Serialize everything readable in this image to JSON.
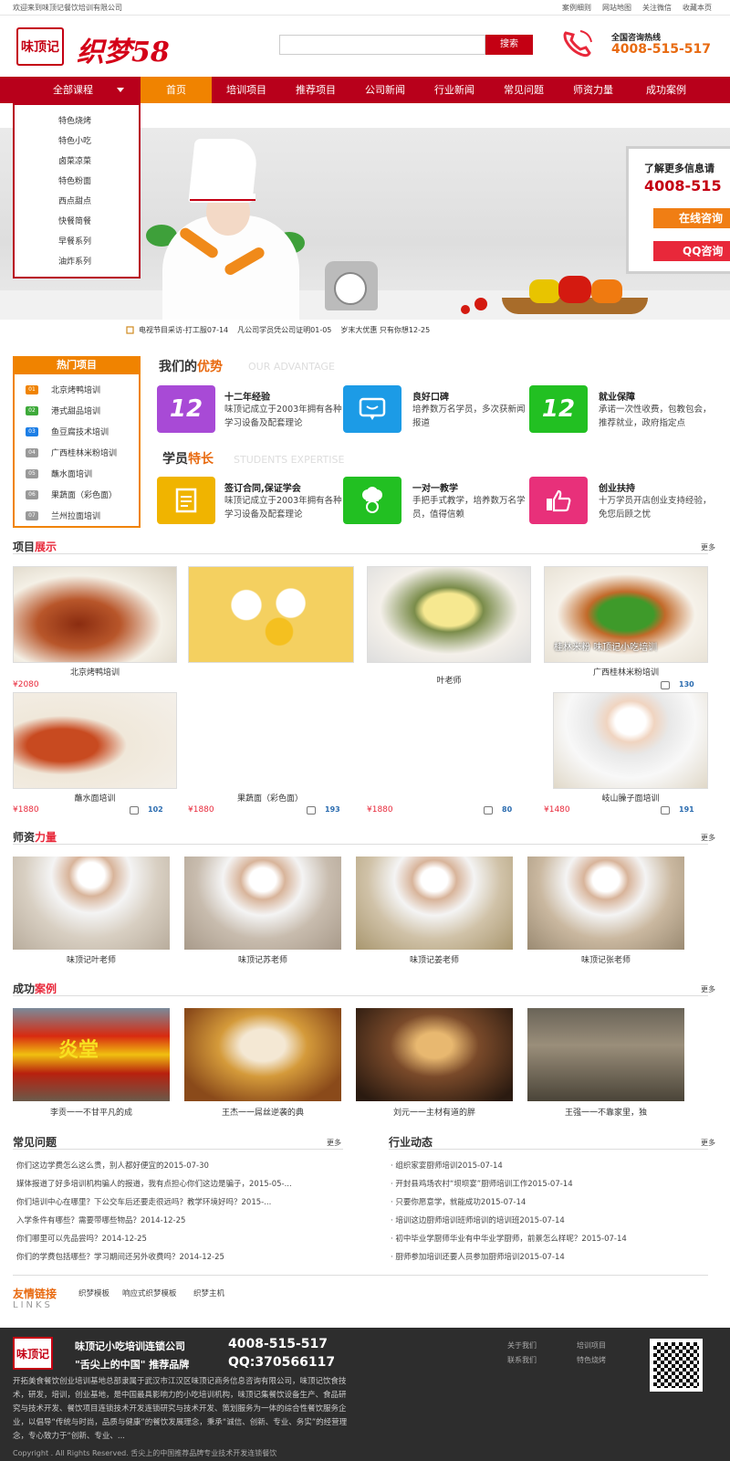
{
  "topbar": {
    "welcome": "欢迎来到味顶记餐饮培训有限公司",
    "links": [
      "案例细则",
      "网站地图",
      "关注微信",
      "收藏本页"
    ]
  },
  "header": {
    "logo_text": "味顶记",
    "brand": "织梦58",
    "search_placeholder": "",
    "search_button": "搜索",
    "hotline_label": "全国咨询热线",
    "hotline_number": "4008-515-517",
    "phone_icon": "phone-icon"
  },
  "nav": {
    "all_courses": "全部课程",
    "items": [
      "首页",
      "培训项目",
      "推荐项目",
      "公司新闻",
      "行业新闻",
      "常见问题",
      "师资力量",
      "成功案例"
    ],
    "active_index": 0,
    "dropdown": [
      "特色烧烤",
      "特色小吃",
      "卤菜凉菜",
      "特色粉面",
      "西点甜点",
      "快餐简餐",
      "早餐系列",
      "油炸系列"
    ]
  },
  "banner": {
    "panel_title": "了解更多信息请",
    "panel_number": "4008-515",
    "online_btn": "在线咨询",
    "qq_btn": "QQ咨询"
  },
  "ticker": [
    "电视节目采访-打工服07-14",
    "凡公司学员凭公司证明01-05",
    "岁末大优惠 只有你想12-25"
  ],
  "hot": {
    "title": "热门项目",
    "items": [
      {
        "num": "01",
        "label": "北京烤鸭培训"
      },
      {
        "num": "02",
        "label": "港式甜品培训"
      },
      {
        "num": "03",
        "label": "鱼豆腐技术培训"
      },
      {
        "num": "04",
        "label": "广西桂林米粉培训"
      },
      {
        "num": "05",
        "label": "蘸水面培训"
      },
      {
        "num": "06",
        "label": "果蔬面（彩色面）"
      },
      {
        "num": "07",
        "label": "兰州拉面培训"
      }
    ]
  },
  "advantage": {
    "title_a": "我们的",
    "title_b": "优势",
    "en": "OUR ADVANTAGE",
    "items": [
      {
        "icon": "12",
        "title": "十二年经验",
        "desc": "味顶记成立于2003年拥有各种学习设备及配套理论"
      },
      {
        "icon": "chat-icon",
        "title": "良好口碑",
        "desc": "培养数万名学员，多次获新闻报道"
      },
      {
        "icon": "12",
        "title": "就业保障",
        "desc": "承诺一次性收费，包教包会，推荐就业，政府指定点"
      }
    ]
  },
  "expertise": {
    "title_a": "学员",
    "title_b": "特长",
    "en": "STUDENTS EXPERTISE",
    "items": [
      {
        "icon": "document-icon",
        "title": "签订合同,保证学会",
        "desc": "味顶记成立于2003年拥有各种学习设备及配套理论"
      },
      {
        "icon": "chef-icon",
        "title": "一对一教学",
        "desc": "手把手式教学，培养数万名学员，值得信赖"
      },
      {
        "icon": "thumbs-up-icon",
        "title": "创业扶持",
        "desc": "十万学员开店创业支持经验，免您后顾之忧"
      }
    ]
  },
  "projects": {
    "title_a": "项目",
    "title_b": "展示",
    "more": "更多",
    "row1": [
      {
        "label": "北京烤鸭培训",
        "price": "¥2080",
        "likes": ""
      },
      {
        "label": "",
        "price": "",
        "likes": ""
      },
      {
        "label": "叶老师",
        "price": "",
        "likes": ""
      },
      {
        "label": "广西桂林米粉培训",
        "price": "",
        "likes": "130",
        "overlay": "桂林米粉 味顶记小吃培训"
      }
    ],
    "row2": [
      {
        "label": "蘸水面培训",
        "price": "¥1880",
        "likes": "102"
      },
      {
        "label": "果蔬面（彩色面）",
        "price": "¥1880",
        "likes": "193"
      },
      {
        "label": "",
        "price": "¥1880",
        "likes": "80"
      },
      {
        "label": "岐山臊子面培训",
        "price": "¥1480",
        "likes": "191"
      }
    ]
  },
  "teachers": {
    "title_a": "师资",
    "title_b": "力量",
    "more": "更多",
    "items": [
      "味顶记叶老师",
      "味顶记苏老师",
      "味顶记姜老师",
      "味顶记张老师"
    ]
  },
  "cases": {
    "title_a": "成功",
    "title_b": "案例",
    "more": "更多",
    "items": [
      "李贡一一不甘平凡的成",
      "王杰一一屌丝逆袭的典",
      "刘元一一主材有道的胖",
      "王强一一不靠家里，独"
    ],
    "sign_text": "炎堂"
  },
  "faq": {
    "title": "常见问题",
    "more": "更多",
    "items": [
      "你们这边学费怎么这么贵，别人都好便宜的2015-07-30",
      "媒体报道了好多培训机构骗人的报道，我有点担心你们这边是骗子，2015-05-...",
      "你们培训中心在哪里？下公交车后还要走很远吗？教学环境好吗？2015-...",
      "入学条件有哪些？需要带哪些物品？2014-12-25",
      "你们哪里可以先品尝吗？2014-12-25",
      "你们的学费包括哪些？学习期间还另外收费吗？2014-12-25"
    ]
  },
  "industry": {
    "title": "行业动态",
    "more": "更多",
    "items": [
      "· 组织家宴厨师培训2015-07-14",
      "· 开封县鸡场农村“坝坝宴”厨师培训工作2015-07-14",
      "· 只要你愿意学，就能成功2015-07-14",
      "· 培训这边厨师培训班师培训的培训班2015-07-14",
      "· 初中毕业学厨师华业有中华业学厨师，前景怎么样呢？2015-07-14",
      "· 厨师参加培训还要人员参加厨师培训2015-07-14"
    ]
  },
  "friend_links": {
    "title": "友情链接",
    "en": "LINKS",
    "items": [
      "织梦模板",
      "响应式织梦模板",
      "织梦主机"
    ]
  },
  "footer": {
    "logo_text": "味顶记",
    "name": "味顶记小吃培训连锁公司",
    "slogan": "\"舌尖上的中国\" 推荐品牌",
    "phone": "4008-515-517",
    "qq": "QQ:370566117",
    "links_col1": [
      "关于我们",
      "联系我们"
    ],
    "links_col2": [
      "培训项目",
      "特色烧烤"
    ],
    "desc": "开拓美食餐饮创业培训基地总部隶属于武汉市江汉区味顶记商务信息咨询有限公司，味顶记饮食技术，研发，培训，创业基地，是中国最具影响力的小吃培训机构，味顶记集餐饮设备生产、食品研究与技术开发、餐饮项目连锁技术开发连锁研究与技术开发、策划服务为一体的综合性餐饮服务企业，以倡导“传统与时尚，品质与健康”的餐饮发展理念，秉承“诚信、创新、专业、务实”的经营理念，专心致力于“创新、专业、...",
    "copyright": "Copyright . All Rights Reserved. 舌尖上的中国推荐品牌专业技术开发连锁餐饮"
  },
  "colors": {
    "brand_red": "#c40013",
    "nav_red": "#b8001b",
    "orange": "#f08300",
    "purple": "#a84ad6",
    "blue": "#1c9be6",
    "green": "#22c022",
    "yellow": "#f0b400",
    "pink": "#e8307a"
  }
}
